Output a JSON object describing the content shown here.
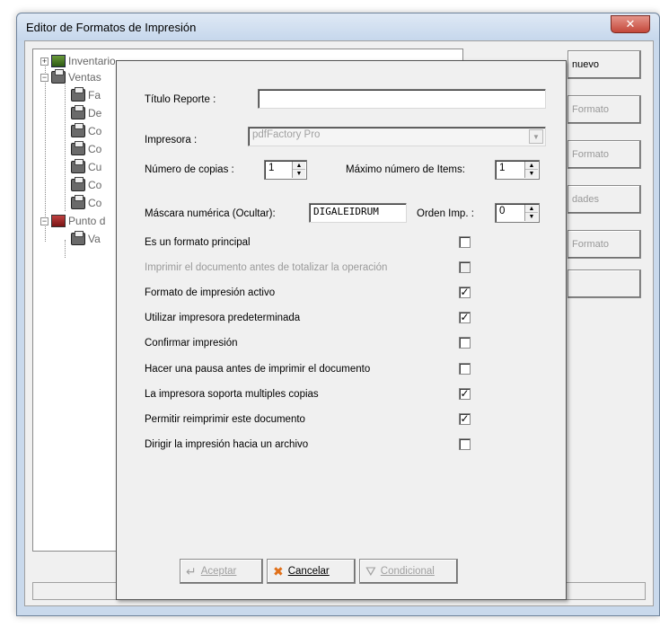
{
  "window": {
    "title": "Editor de Formatos de Impresión",
    "close_glyph": "✕"
  },
  "tree": [
    {
      "label": "Inventario",
      "expander": "+"
    },
    {
      "label": "Ventas",
      "expander": "−"
    },
    {
      "label": "Fa"
    },
    {
      "label": "De"
    },
    {
      "label": "Co"
    },
    {
      "label": "Co"
    },
    {
      "label": "Cu"
    },
    {
      "label": "Co"
    },
    {
      "label": "Co"
    },
    {
      "label": "Punto d",
      "expander": "−"
    },
    {
      "label": "Va"
    }
  ],
  "outer_buttons": [
    {
      "label": "nuevo"
    },
    {
      "label": "Formato"
    },
    {
      "label": "Formato"
    },
    {
      "label": "dades"
    },
    {
      "label": "Formato"
    },
    {
      "label": ""
    }
  ],
  "dialog": {
    "titulo_label": "Título Reporte :",
    "titulo_value": "",
    "impresora_label": "Impresora :",
    "impresora_value": "pdfFactory Pro",
    "copias_label": "Número de copias :",
    "copias_value": "1",
    "max_items_label": "Máximo número de Items:",
    "max_items_value": "1",
    "mascara_label": "Máscara numérica (Ocultar):",
    "mascara_value": "DIGALEIDRUM",
    "orden_label": "Orden  Imp. :",
    "orden_value": "0",
    "checkboxes": [
      {
        "label": "Es un formato principal",
        "checked": ""
      },
      {
        "label": "Imprimir el documento antes de totalizar la operación",
        "checked": ""
      },
      {
        "label": "Formato de impresión activo",
        "checked": "✓"
      },
      {
        "label": "Utilizar impresora predeterminada",
        "checked": "✓"
      },
      {
        "label": "Confirmar impresión",
        "checked": ""
      },
      {
        "label": "Hacer una pausa antes de imprimir el documento",
        "checked": ""
      },
      {
        "label": "La impresora soporta multiples copias",
        "checked": "✓"
      },
      {
        "label": "Permitir reimprimir  este documento",
        "checked": "✓"
      },
      {
        "label": "Dirigir la impresión hacia un archivo",
        "checked": ""
      }
    ],
    "btn_aceptar": "Aceptar",
    "btn_cancelar": "Cancelar",
    "btn_condicional": "Condicional",
    "icon_aceptar": "↵",
    "icon_cancelar": "✖",
    "icon_condicional": "⛛"
  },
  "colors": {
    "cancel_icon": "#e0701a",
    "close_button": "#c4473a"
  }
}
